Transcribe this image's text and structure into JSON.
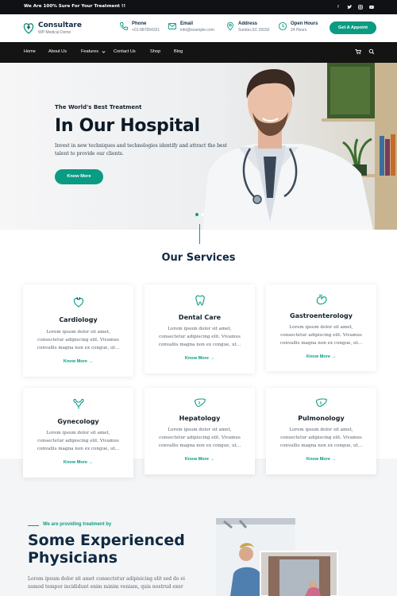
{
  "topbar": {
    "message": "We Are 100% Sure For Your Treatment !!"
  },
  "social_icons": [
    "facebook-icon",
    "twitter-icon",
    "instagram-icon",
    "youtube-icon"
  ],
  "brand": {
    "title": "Consultare",
    "subtitle": "WP Medical Demo"
  },
  "contact": {
    "phone_label": "Phone",
    "phone_value": "+01-987654321",
    "email_label": "Email",
    "email_value": "info@example.com",
    "address_label": "Address",
    "address_value": "Sumter,SC 29150",
    "hours_label": "Open Hours",
    "hours_value": "24 Hours"
  },
  "appoint_label": "Get A Appoint",
  "nav": {
    "items": [
      "Home",
      "About Us",
      "Features",
      "Contact Us",
      "Shop",
      "Blog"
    ]
  },
  "hero": {
    "kicker": "The World's Best Treatment",
    "title": "In Our Hospital",
    "text": "Invest in new techniques and technologies identify and attract the best talent to provide our clients.",
    "button": "Know More"
  },
  "services": {
    "title": "Our Services",
    "items": [
      {
        "name": "Cardiology",
        "text": "Lorem ipsum dolor sit amet, consectetur adipiscing elit. Vivamus convallis magna non ex congue, ut...",
        "link": "Know More →",
        "icon": "heart-icon"
      },
      {
        "name": "Dental Care",
        "text": "Lorem ipsum dolor sit amet, consectetur adipiscing elit. Vivamus convallis magna non ex congue, ut...",
        "link": "Know More →",
        "icon": "tooth-icon"
      },
      {
        "name": "Gastroenterology",
        "text": "Lorem ipsum dolor sit amet, consectetur adipiscing elit. Vivamus convallis magna non ex congue, ut...",
        "link": "Know More →",
        "icon": "stomach-icon"
      },
      {
        "name": "Gynecology",
        "text": "Lorem ipsum dolor sit amet, consectetur adipiscing elit. Vivamus convallis magna non ex congue, ut...",
        "link": "Know More →",
        "icon": "uterus-icon"
      },
      {
        "name": "Hepatology",
        "text": "Lorem ipsum dolor sit amet, consectetur adipiscing elit. Vivamus convallis magna non ex congue, ut...",
        "link": "Know More →",
        "icon": "liver-icon"
      },
      {
        "name": "Pulmonology",
        "text": "Lorem ipsum dolor sit amet, consectetur adipiscing elit. Vivamus convallis magna non ex congue, ut...",
        "link": "Know More →",
        "icon": "lungs-icon"
      }
    ]
  },
  "physicians": {
    "kicker": "We are providing treatment by",
    "title_line1": "Some Experienced",
    "title_line2": "Physicians",
    "text": "Lorem ipsum dolor sit amet consectetur adipisicing elit sed do ei usmod tempor incididunt enim minim veniam, quis nostrud exer"
  },
  "colors": {
    "accent": "#0a9b83",
    "dark": "#102a43",
    "topbar": "#0f1115",
    "nav": "#141414"
  }
}
